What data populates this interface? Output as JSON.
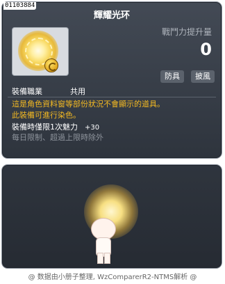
{
  "item": {
    "id": "01103884",
    "name": "輝耀光环"
  },
  "stats": {
    "power_label": "戰鬥力提升量",
    "power_value": "0"
  },
  "tags": [
    "防具",
    "披風"
  ],
  "job": {
    "label": "裝備職業",
    "value": "共用"
  },
  "description": {
    "line1": "這是角色資料窗等部份狀況不會顯示的道具。",
    "line2": "此裝備可進行染色。",
    "line3": "裝備時僅限1次魅力",
    "line3_bonus": "+30",
    "line4": "每日限制、超過上限時除外"
  },
  "footer": "@ 数据由小册子整理, WzComparerR2-NTMS解析 @"
}
